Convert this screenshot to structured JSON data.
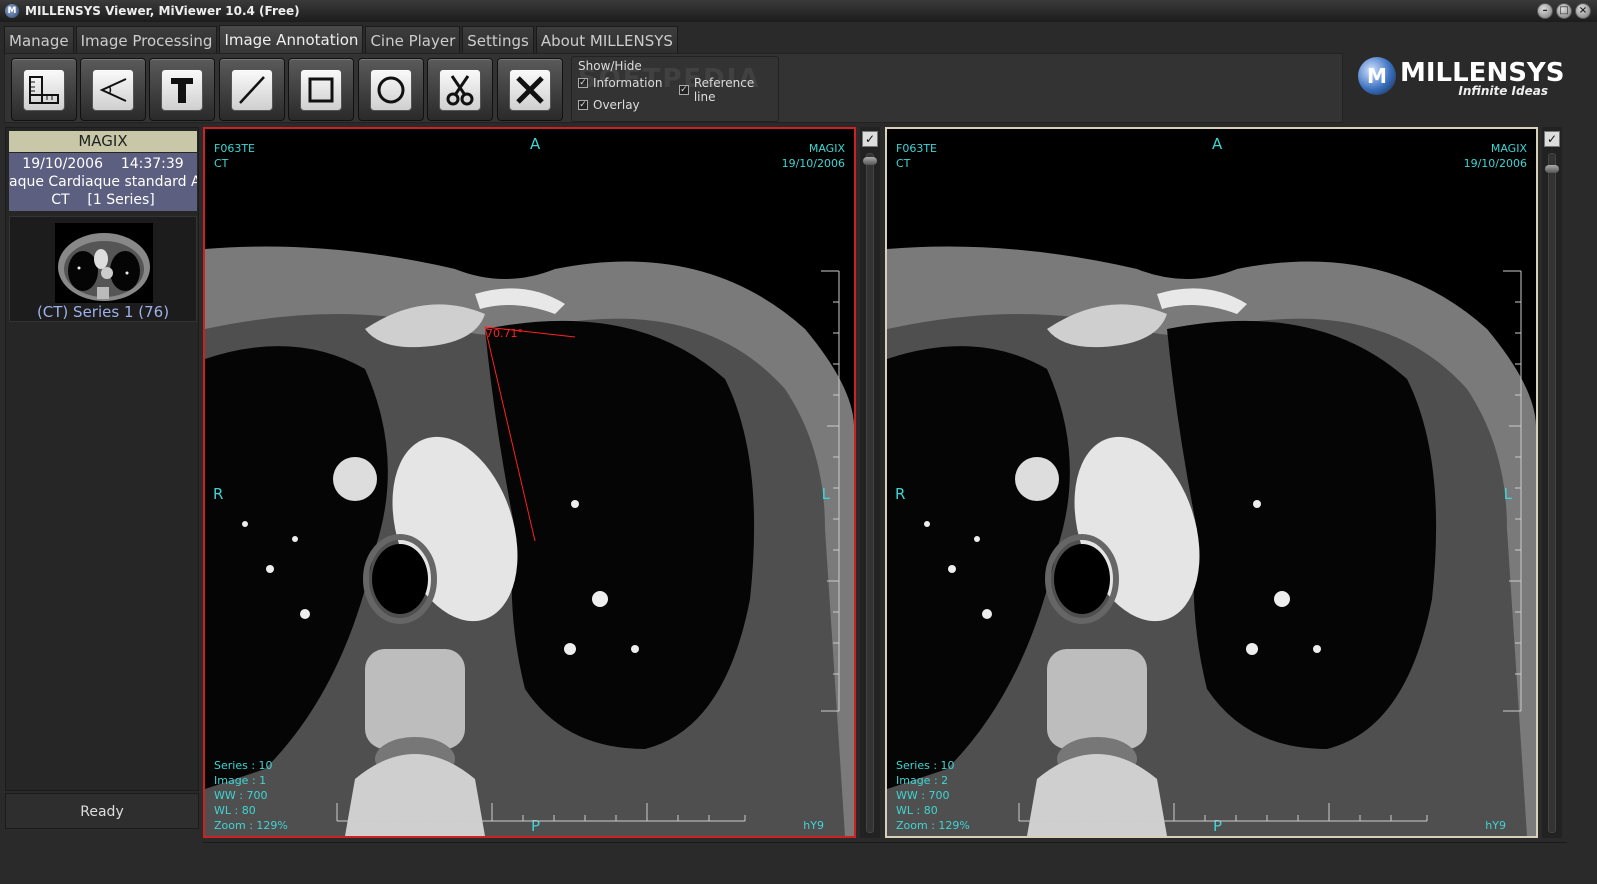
{
  "window": {
    "title": "MILLENSYS Viewer, MiViewer 10.4 (Free)",
    "app_icon": "M"
  },
  "tabs": [
    {
      "label": "Manage"
    },
    {
      "label": "Image Processing"
    },
    {
      "label": "Image Annotation",
      "active": true
    },
    {
      "label": "Cine Player"
    },
    {
      "label": "Settings"
    },
    {
      "label": "About MILLENSYS"
    }
  ],
  "toolbar": {
    "tools": [
      {
        "icon": "ruler-icon"
      },
      {
        "icon": "angle-icon"
      },
      {
        "icon": "text-icon"
      },
      {
        "icon": "line-icon"
      },
      {
        "icon": "rectangle-icon"
      },
      {
        "icon": "ellipse-icon"
      },
      {
        "icon": "cut-icon"
      },
      {
        "icon": "delete-icon"
      }
    ],
    "show_hide": {
      "legend": "Show/Hide",
      "information": "Information",
      "reference_line": "Reference line",
      "overlay": "Overlay"
    },
    "watermark": "SOFTPEDIA"
  },
  "logo": {
    "name": "MILLENSYS",
    "slogan": "Infinite Ideas",
    "mark": "M"
  },
  "study": {
    "header": "MAGIX",
    "date": "19/10/2006",
    "time": "14:37:39",
    "description": "aque Cardiaque standard  Ad",
    "modality": "CT",
    "series_count": "[1 Series]",
    "series_label": "(CT) Series 1 (76)"
  },
  "status": "Ready",
  "viewports": [
    {
      "patient_id": "F063TE",
      "modality": "CT",
      "institution": "MAGIX",
      "date": "19/10/2006",
      "orient_top": "A",
      "orient_left": "R",
      "orient_right": "L",
      "orient_bottom": "P",
      "series": "Series : 10",
      "image": "Image : 1",
      "ww": "WW    : 700",
      "wl": "WL    : 80",
      "zoom": "Zoom : 129%",
      "corner": "hY9",
      "angle_label": "70.71°"
    },
    {
      "patient_id": "F063TE",
      "modality": "CT",
      "institution": "MAGIX",
      "date": "19/10/2006",
      "orient_top": "A",
      "orient_left": "R",
      "orient_right": "L",
      "orient_bottom": "P",
      "series": "Series : 10",
      "image": "Image : 2",
      "ww": "WW    : 700",
      "wl": "WL    : 80",
      "zoom": "Zoom : 129%",
      "corner": "hY9"
    }
  ],
  "colors": {
    "overlay_text": "#3fd4d4",
    "active_border": "#cc2222",
    "annotation": "#ff2020"
  }
}
